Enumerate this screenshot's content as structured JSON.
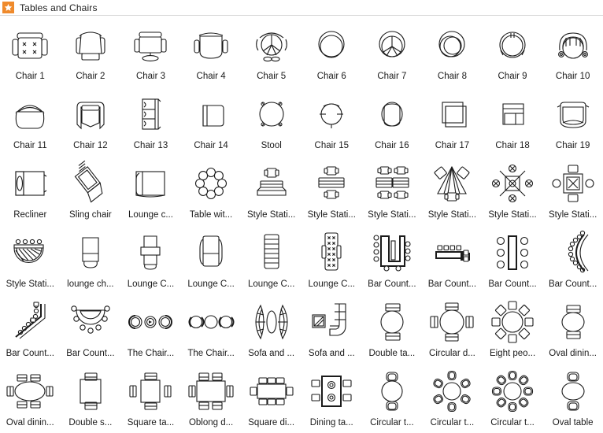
{
  "window": {
    "title": "Tables and Chairs",
    "icon": "star-icon",
    "accent_color": "#ef8a2c",
    "background_color": "#ffffff",
    "label_color": "#1a1a1a",
    "stroke_color": "#1b1b1b"
  },
  "library": {
    "columns": 10,
    "rows": 6,
    "count": 60,
    "items": [
      {
        "label": "Chair 1",
        "icon": "chair-armchair-square-top"
      },
      {
        "label": "Chair 2",
        "icon": "chair-curved-back-arms"
      },
      {
        "label": "Chair 3",
        "icon": "chair-office-pedestal"
      },
      {
        "label": "Chair 4",
        "icon": "chair-rounded-arms"
      },
      {
        "label": "Chair 5",
        "icon": "chair-swivel-star-base"
      },
      {
        "label": "Chair 6",
        "icon": "chair-round-double-ring"
      },
      {
        "label": "Chair 7",
        "icon": "chair-round-five-spoke"
      },
      {
        "label": "Chair 8",
        "icon": "chair-round-crescent-back"
      },
      {
        "label": "Chair 9",
        "icon": "chair-round-split-back"
      },
      {
        "label": "Chair 10",
        "icon": "chair-round-tufted-scroll-arms"
      },
      {
        "label": "Chair 11",
        "icon": "chair-dome-back-tub"
      },
      {
        "label": "Chair 12",
        "icon": "chair-tub-draped"
      },
      {
        "label": "Chair 13",
        "icon": "chair-bench-three-seat"
      },
      {
        "label": "Chair 14",
        "icon": "chair-square-side-panel"
      },
      {
        "label": "Stool",
        "icon": "stool-round-four-leg"
      },
      {
        "label": "Chair 15",
        "icon": "chair-round-cross-legs"
      },
      {
        "label": "Chair 16",
        "icon": "chair-oval-tub"
      },
      {
        "label": "Chair 17",
        "icon": "chair-square-nested"
      },
      {
        "label": "Chair 18",
        "icon": "chair-square-arm-block"
      },
      {
        "label": "Chair 19",
        "icon": "chair-wide-tub-arms"
      },
      {
        "label": "Recliner",
        "icon": "recliner-side-view"
      },
      {
        "label": "Sling chair",
        "icon": "sling-chair-angled"
      },
      {
        "label": "Lounge c...",
        "icon": "lounge-chair-square"
      },
      {
        "label": "Table wit...",
        "icon": "table-with-eight-chairs-circle"
      },
      {
        "label": "Style Stati...",
        "icon": "style-station-single-counter"
      },
      {
        "label": "Style Stati...",
        "icon": "style-station-double-counter"
      },
      {
        "label": "Style Stati...",
        "icon": "style-station-four-seat-bench"
      },
      {
        "label": "Style Stati...",
        "icon": "style-station-triangle-fan"
      },
      {
        "label": "Style Stati...",
        "icon": "style-station-x-four-mirror"
      },
      {
        "label": "Style Stati...",
        "icon": "style-station-square-x-four"
      },
      {
        "label": "Style Stati...",
        "icon": "style-station-half-round-hatched"
      },
      {
        "label": "lounge ch...",
        "icon": "lounge-chair-narrow-ottoman"
      },
      {
        "label": "Lounge C...",
        "icon": "lounge-chair-banded"
      },
      {
        "label": "Lounge C...",
        "icon": "lounge-chair-rounded-rect"
      },
      {
        "label": "Lounge C...",
        "icon": "lounge-chair-ribbed"
      },
      {
        "label": "Lounge C...",
        "icon": "lounge-chair-tufted-grid"
      },
      {
        "label": "Bar Count...",
        "icon": "bar-counter-u-shape-stools"
      },
      {
        "label": "Bar Count...",
        "icon": "bar-counter-l-shape-stools"
      },
      {
        "label": "Bar Count...",
        "icon": "bar-counter-straight-six-stools"
      },
      {
        "label": "Bar Count...",
        "icon": "bar-counter-curved-stools"
      },
      {
        "label": "Bar Count...",
        "icon": "bar-counter-angled-stools"
      },
      {
        "label": "Bar Count...",
        "icon": "bar-counter-semicircle-stools"
      },
      {
        "label": "The Chair...",
        "icon": "chair-group-three-round"
      },
      {
        "label": "The Chair...",
        "icon": "chair-group-three-armchair"
      },
      {
        "label": "Sofa and ...",
        "icon": "sofa-and-chairs-curved-pair"
      },
      {
        "label": "Sofa and ...",
        "icon": "sofa-and-table-corner-l"
      },
      {
        "label": "Double ta...",
        "icon": "double-table-round-two-chairs"
      },
      {
        "label": "Circular d...",
        "icon": "circular-dining-four-chairs"
      },
      {
        "label": "Eight peo...",
        "icon": "eight-people-round-table"
      },
      {
        "label": "Oval dinin...",
        "icon": "oval-dining-two-chairs"
      },
      {
        "label": "Oval dinin...",
        "icon": "oval-dining-six-chairs"
      },
      {
        "label": "Double s...",
        "icon": "double-square-table-two-chairs"
      },
      {
        "label": "Square ta...",
        "icon": "square-table-four-chairs"
      },
      {
        "label": "Oblong d...",
        "icon": "oblong-dining-six-chairs"
      },
      {
        "label": "Square di...",
        "icon": "square-dining-six-chairs"
      },
      {
        "label": "Dining ta...",
        "icon": "dining-table-bold-four-chairs"
      },
      {
        "label": "Circular t...",
        "icon": "circular-table-two-chairs"
      },
      {
        "label": "Circular t...",
        "icon": "circular-table-six-chairs"
      },
      {
        "label": "Circular t...",
        "icon": "circular-table-eight-chairs"
      },
      {
        "label": "Oval table",
        "icon": "oval-table-two-chairs"
      }
    ]
  }
}
